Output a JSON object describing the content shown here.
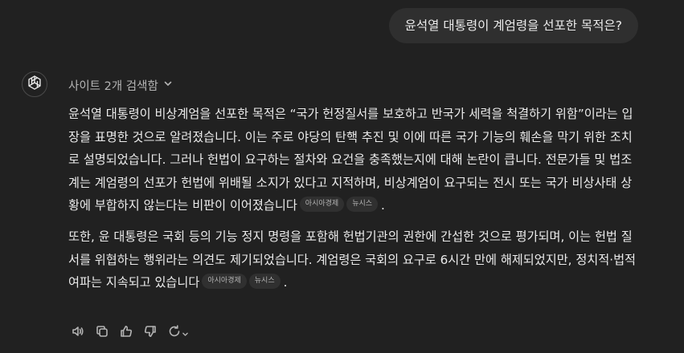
{
  "user_message": "윤석열 대통령이 계엄령을 선포한 목적은?",
  "assistant": {
    "sources_label": "사이트 2개 검색함",
    "paragraphs": [
      {
        "text": "윤석열 대통령이 비상계엄을 선포한 목적은 “국가 헌정질서를 보호하고 반국가 세력을 척결하기 위함”이라는 입장을 표명한 것으로 알려졌습니다. 이는 주로 야당의 탄핵 추진 및 이에 따른 국가 기능의 훼손을 막기 위한 조치로 설명되었습니다. 그러나 헌법이 요구하는 절차와 요건을 충족했는지에 대해 논란이 큽니다. 전문가들 및 법조계는 계엄령의 선포가 헌법에 위배될 소지가 있다고 지적하며, 비상계엄이 요구되는 전시 또는 국가 비상사태 상황에 부합하지 않는다는 비판이 이어졌습니다",
        "citations": [
          "아시아경제",
          "뉴시스"
        ],
        "end": "."
      },
      {
        "text": "또한, 윤 대통령은 국회 등의 기능 정지 명령을 포함해 헌법기관의 권한에 간섭한 것으로 평가되며, 이는 헌법 질서를 위협하는 행위라는 의견도 제기되었습니다. 계엄령은 국회의 요구로 6시간 만에 해제되었지만, 정치적·법적 여파는 지속되고 있습니다",
        "citations": [
          "아시아경제",
          "뉴시스"
        ],
        "end": "."
      }
    ]
  },
  "actions": [
    {
      "icon": "speaker-icon",
      "name": "read-aloud-button"
    },
    {
      "icon": "copy-icon",
      "name": "copy-button"
    },
    {
      "icon": "thumbs-up-icon",
      "name": "good-response-button"
    },
    {
      "icon": "thumbs-down-icon",
      "name": "bad-response-button"
    },
    {
      "icon": "regenerate-icon",
      "name": "regenerate-button"
    }
  ],
  "colors": {
    "background": "#212121",
    "user_bubble": "#2f2f2f",
    "text": "#ececec",
    "muted": "#b4b4b4",
    "citation_bg": "#303030"
  }
}
